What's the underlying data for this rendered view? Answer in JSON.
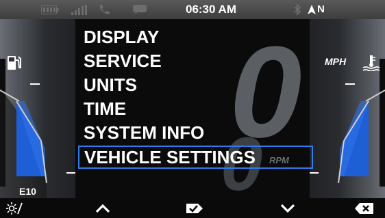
{
  "status_bar": {
    "time": "06:30 AM",
    "heading": "N",
    "icons": [
      "battery-icon",
      "signal-icon",
      "phone-icon",
      "message-icon",
      "bluetooth-icon",
      "compass-arrow-icon"
    ]
  },
  "gauges": {
    "speed_unit": "MPH",
    "fuel_label": "E10",
    "speed_value": "0",
    "rpm_label": "RPM",
    "left_icon": "fuel-pump-icon",
    "right_icon": "coolant-temp-icon"
  },
  "menu": {
    "items": [
      "DISPLAY",
      "SERVICE",
      "UNITS",
      "TIME",
      "SYSTEM INFO",
      "VEHICLE SETTINGS"
    ],
    "selected": "VEHICLE SETTINGS"
  },
  "bottom_bar": {
    "buttons": [
      "day-night-icon",
      "up-arrow-icon",
      "select-check-icon",
      "down-arrow-icon",
      "back-delete-icon"
    ]
  },
  "colors": {
    "selection_border": "#2f7cf0",
    "gauge_fill": "#1f5fd6"
  }
}
